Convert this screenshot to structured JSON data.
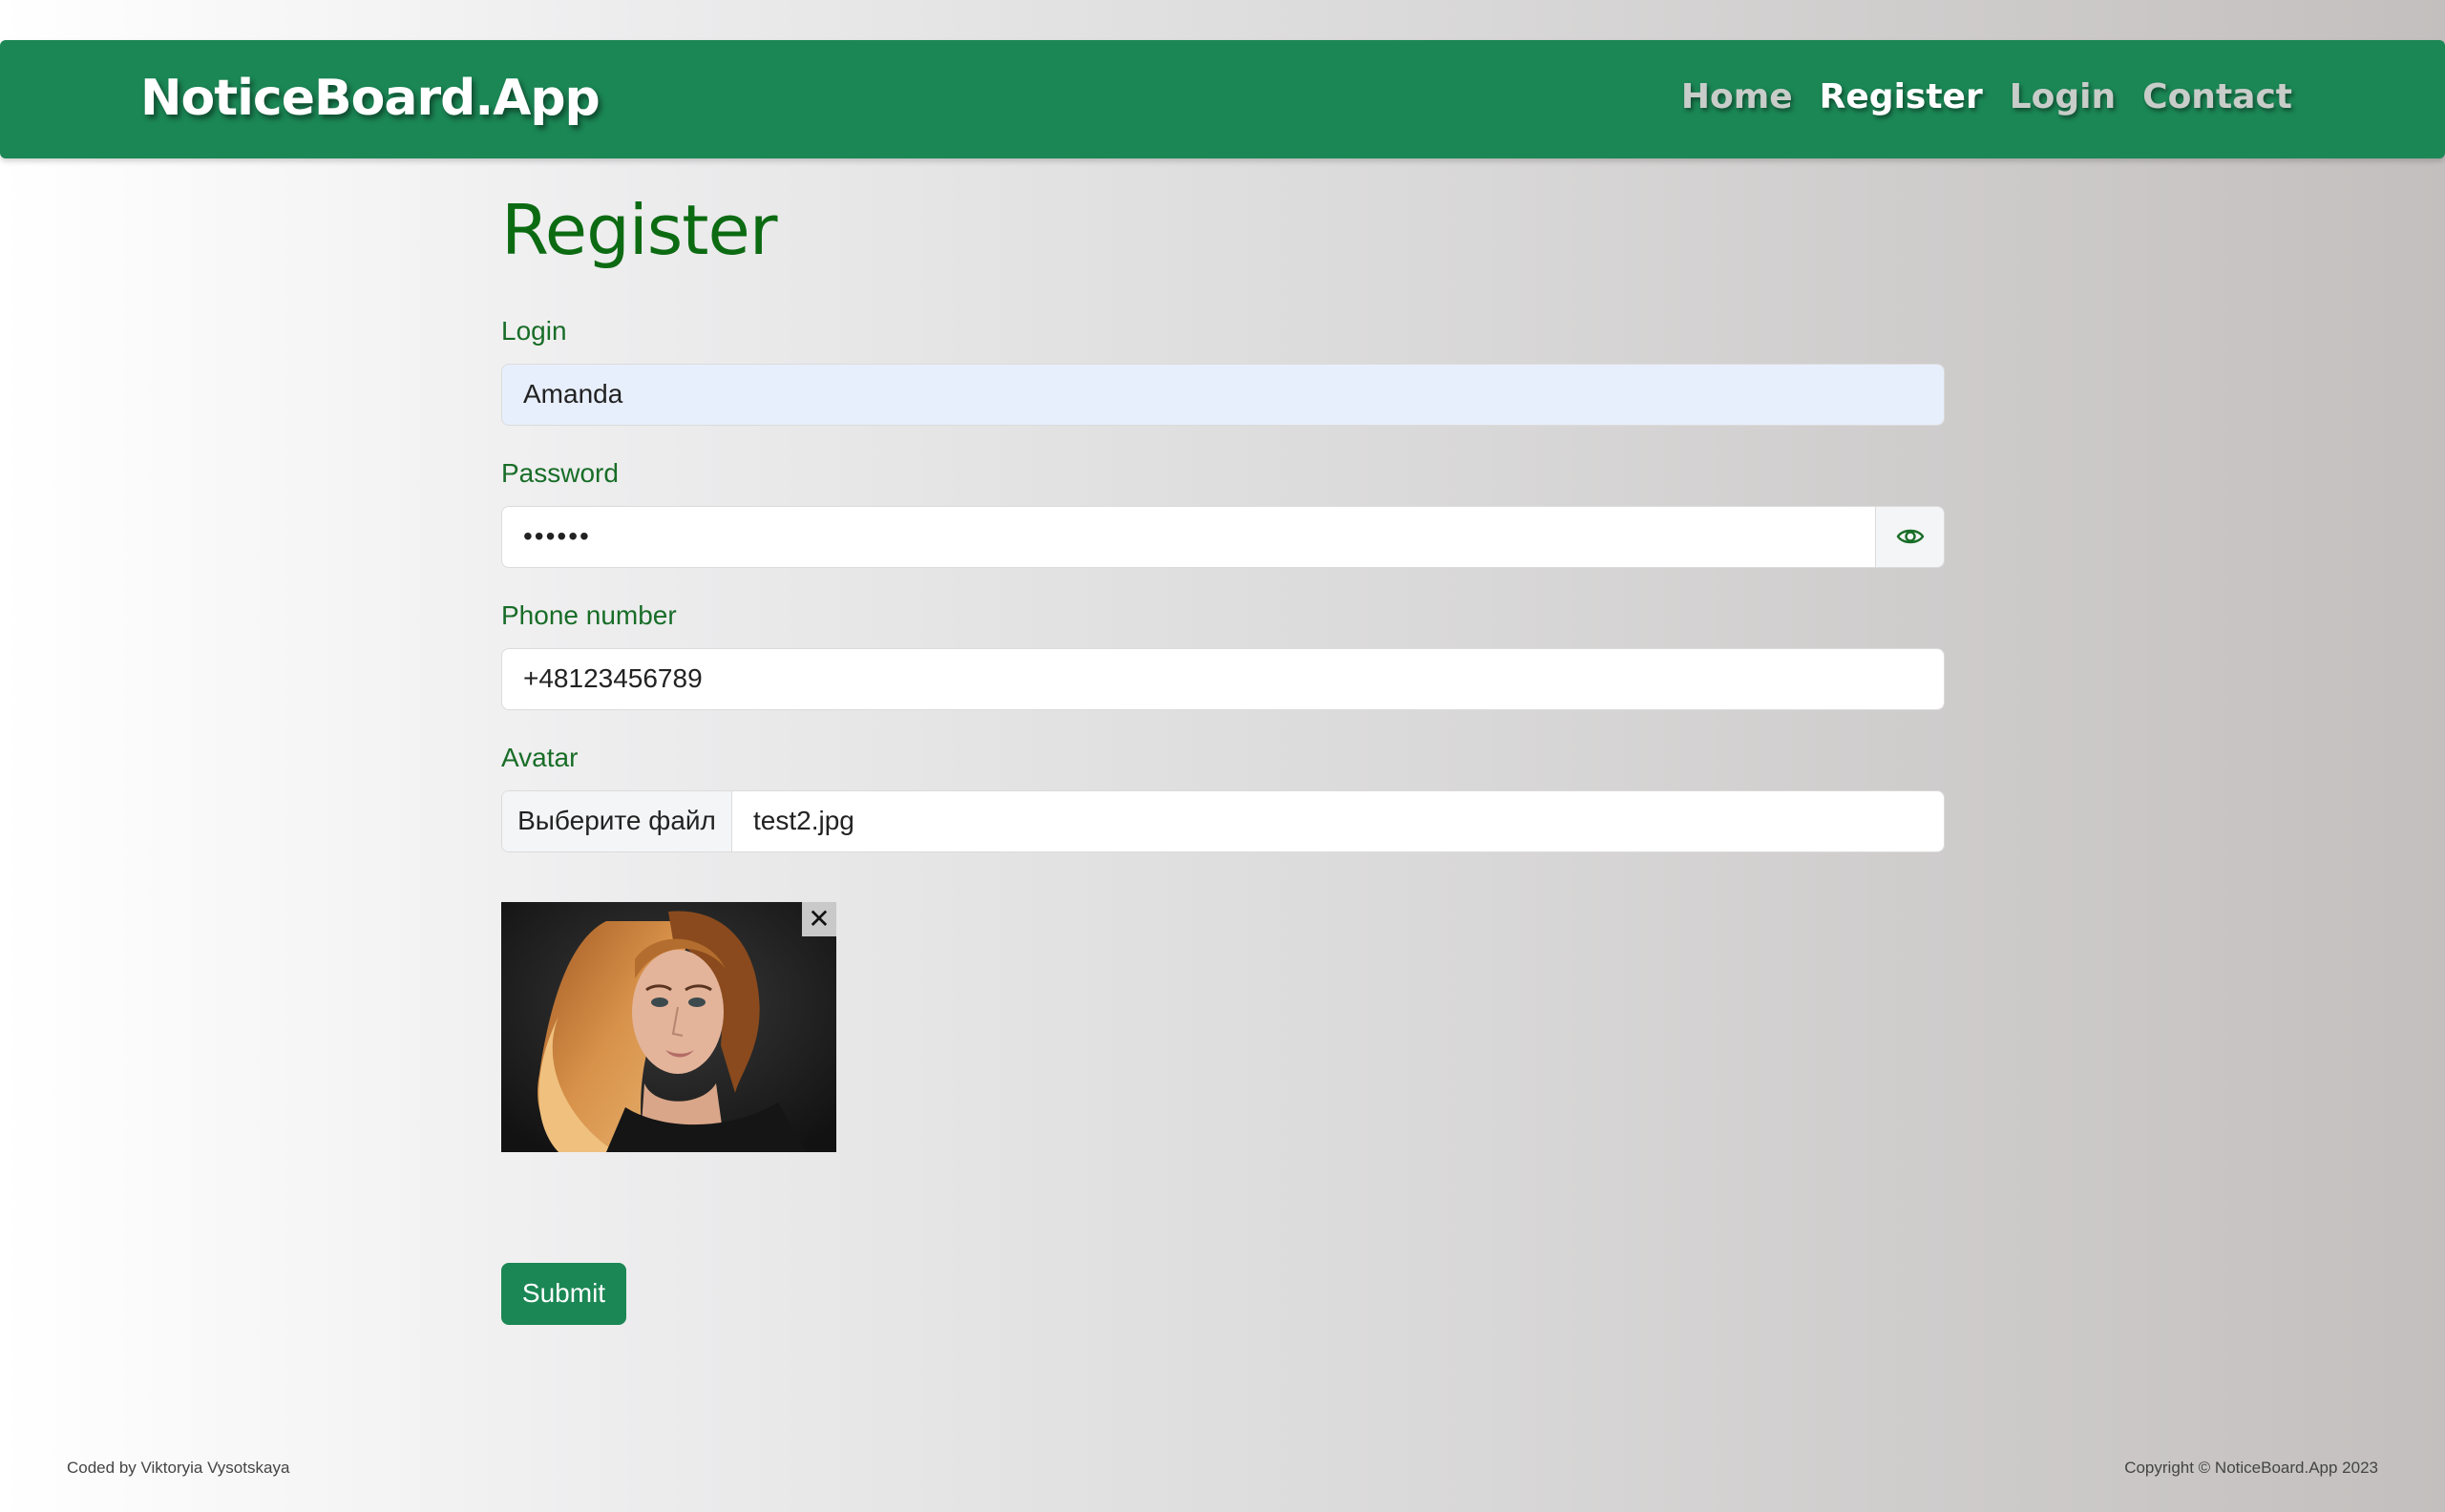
{
  "app": {
    "brand": "NoticeBoard.App",
    "nav": [
      {
        "label": "Home",
        "active": false
      },
      {
        "label": "Register",
        "active": true
      },
      {
        "label": "Login",
        "active": false
      },
      {
        "label": "Contact",
        "active": false
      }
    ]
  },
  "page": {
    "title": "Register"
  },
  "form": {
    "login": {
      "label": "Login",
      "value": "Amanda"
    },
    "password": {
      "label": "Password",
      "value": "••••••",
      "toggle_icon": "eye-icon"
    },
    "phone": {
      "label": "Phone number",
      "value": "+48123456789"
    },
    "avatar": {
      "label": "Avatar",
      "button_label": "Выберите файл",
      "file_name": "test2.jpg",
      "remove_label": "✕"
    },
    "submit_label": "Submit"
  },
  "footer": {
    "left": "Coded by Viktoryia Vysotskaya",
    "right": "Copyright © NoticeBoard.App 2023"
  },
  "colors": {
    "navbar": "#1b8755",
    "title": "#0c6b12",
    "label": "#186d27",
    "login_fill": "#e8effc"
  }
}
